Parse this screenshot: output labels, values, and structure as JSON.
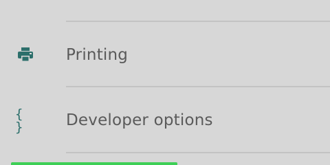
{
  "settings_list": {
    "items": [
      {
        "label": "Printing",
        "icon": "printer-icon"
      },
      {
        "label": "Developer options",
        "icon": "braces-icon",
        "icon_glyph": "{ }"
      }
    ]
  },
  "colors": {
    "background": "#d7d7d7",
    "divider": "#c3c3c3",
    "icon_accent": "#2c6f6b",
    "label_text": "#5a5a5a",
    "progress_green": "#3ecf56"
  }
}
